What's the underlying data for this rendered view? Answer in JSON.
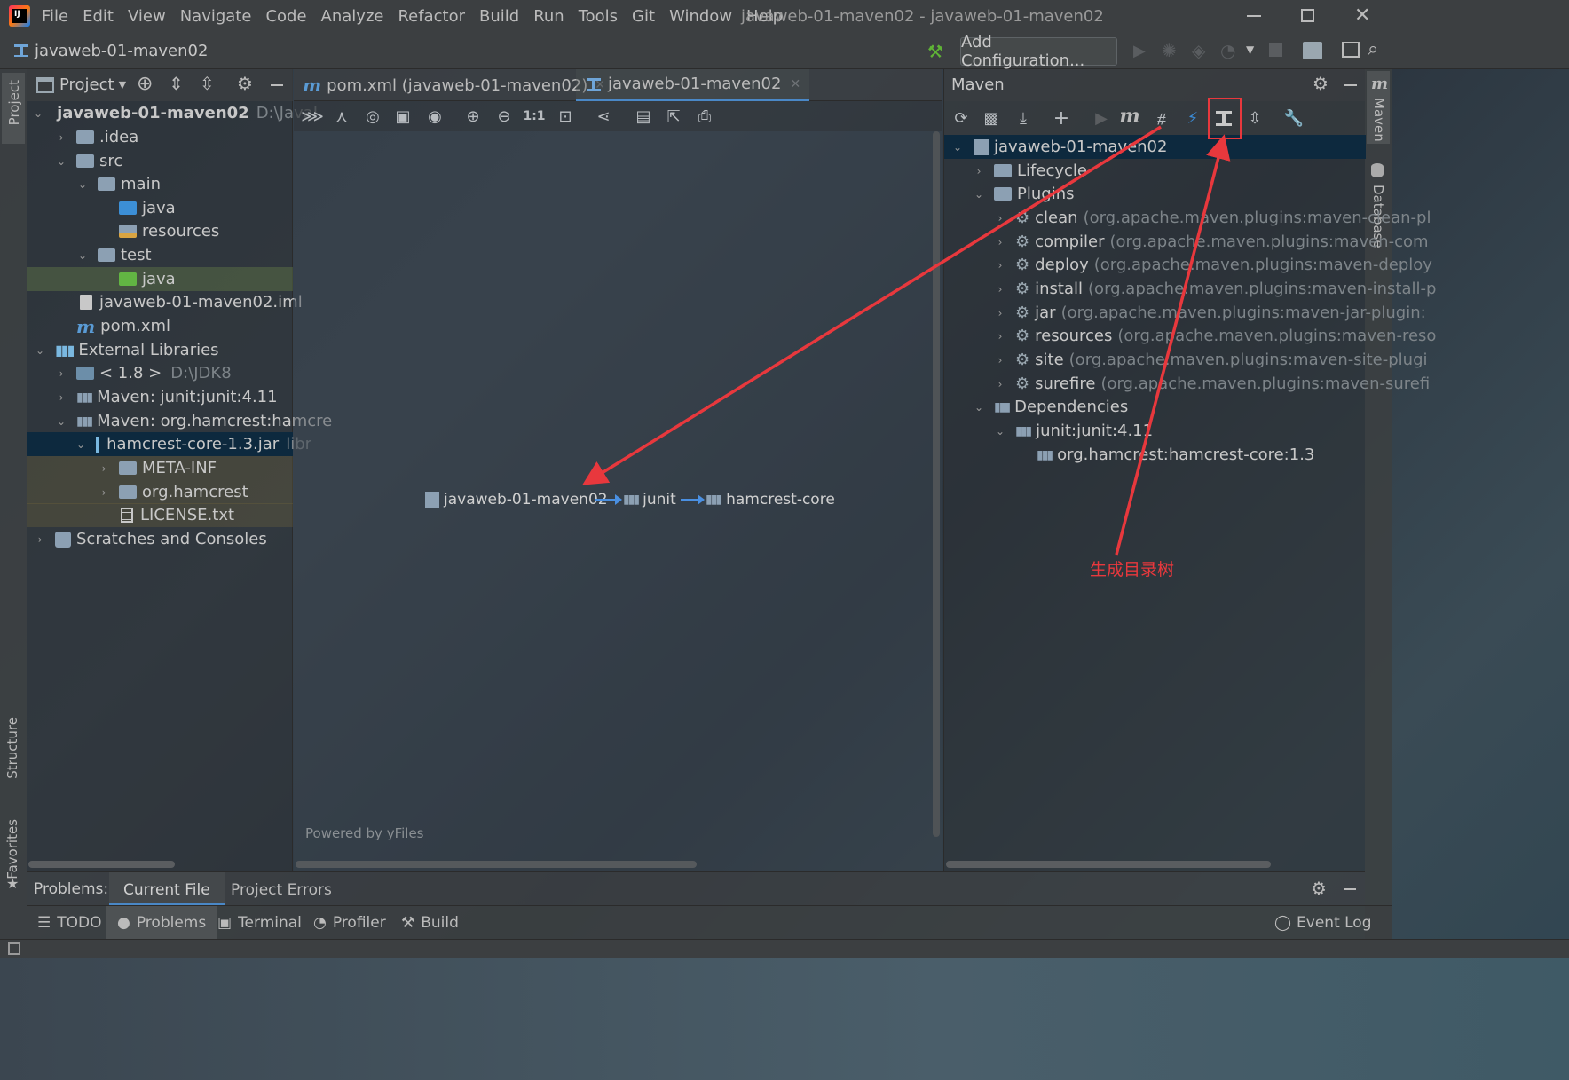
{
  "window": {
    "title": "javaweb-01-maven02 - javaweb-01-maven02",
    "menu": [
      "File",
      "Edit",
      "View",
      "Navigate",
      "Code",
      "Analyze",
      "Refactor",
      "Build",
      "Run",
      "Tools",
      "Git",
      "Window",
      "Help"
    ]
  },
  "navbar": {
    "breadcrumb": "javaweb-01-maven02",
    "run_config": "Add Configuration..."
  },
  "left_stripe": {
    "project": "Project",
    "structure": "Structure",
    "favorites": "Favorites"
  },
  "right_stripe": {
    "maven": "Maven",
    "database": "Database"
  },
  "project_panel": {
    "title": "Project",
    "tree": [
      {
        "label": "javaweb-01-maven02",
        "extra": "D:\\JavaI",
        "bold": true
      },
      {
        "label": ".idea"
      },
      {
        "label": "src"
      },
      {
        "label": "main"
      },
      {
        "label": "java"
      },
      {
        "label": "resources"
      },
      {
        "label": "test"
      },
      {
        "label": "java"
      },
      {
        "label": "javaweb-01-maven02.iml"
      },
      {
        "label": "pom.xml"
      },
      {
        "label": "External Libraries"
      },
      {
        "label": "< 1.8 >",
        "extra": "D:\\JDK8"
      },
      {
        "label": "Maven: junit:junit:4.11"
      },
      {
        "label": "Maven: org.hamcrest:hamcre"
      },
      {
        "label": "hamcrest-core-1.3.jar",
        "extra": "libr"
      },
      {
        "label": "META-INF"
      },
      {
        "label": "org.hamcrest"
      },
      {
        "label": "LICENSE.txt"
      },
      {
        "label": "Scratches and Consoles"
      }
    ]
  },
  "editor": {
    "tabs": [
      {
        "label": "pom.xml (javaweb-01-maven02)"
      },
      {
        "label": "javaweb-01-maven02"
      }
    ],
    "diagram": {
      "nodes": [
        "javaweb-01-maven02",
        "junit",
        "hamcrest-core"
      ],
      "footer": "Powered by yFiles"
    }
  },
  "maven_panel": {
    "title": "Maven",
    "tree": [
      {
        "label": "javaweb-01-maven02"
      },
      {
        "label": "Lifecycle"
      },
      {
        "label": "Plugins"
      },
      {
        "label": "clean",
        "extra": "(org.apache.maven.plugins:maven-clean-pl"
      },
      {
        "label": "compiler",
        "extra": "(org.apache.maven.plugins:maven-com"
      },
      {
        "label": "deploy",
        "extra": "(org.apache.maven.plugins:maven-deploy"
      },
      {
        "label": "install",
        "extra": "(org.apache.maven.plugins:maven-install-p"
      },
      {
        "label": "jar",
        "extra": "(org.apache.maven.plugins:maven-jar-plugin:"
      },
      {
        "label": "resources",
        "extra": "(org.apache.maven.plugins:maven-reso"
      },
      {
        "label": "site",
        "extra": "(org.apache.maven.plugins:maven-site-plugi"
      },
      {
        "label": "surefire",
        "extra": "(org.apache.maven.plugins:maven-surefi"
      },
      {
        "label": "Dependencies"
      },
      {
        "label": "junit:junit:4.11"
      },
      {
        "label": "org.hamcrest:hamcrest-core:1.3"
      }
    ]
  },
  "annotation": {
    "label": "生成目录树",
    "color": "#e8383d"
  },
  "problems_bar": {
    "title": "Problems:",
    "tabs": [
      "Current File",
      "Project Errors"
    ]
  },
  "bottom_tools": [
    "TODO",
    "Problems",
    "Terminal",
    "Profiler",
    "Build"
  ],
  "event_log": "Event Log",
  "colors": {
    "accent": "#4a88c7",
    "annotation": "#e8383d",
    "selection": "#0d293e"
  }
}
